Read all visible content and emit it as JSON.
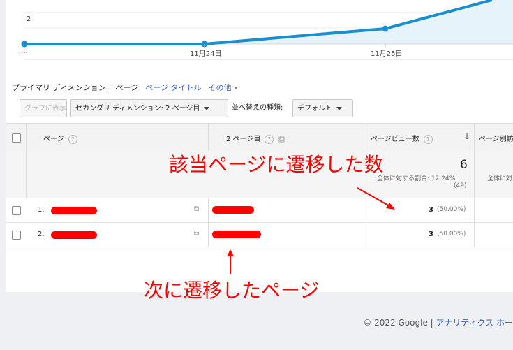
{
  "chart": {
    "y_tick": "2",
    "x_ticks": [
      "…",
      "11月24日",
      "11月25日"
    ],
    "line_color": "#1a8fd0",
    "fill_color": "#e6f3fb"
  },
  "dimension_bar": {
    "primary_label": "プライマリ ディメンション:",
    "current": "ページ",
    "page_title_link": "ページ タイトル",
    "other_link": "その他"
  },
  "toolbar": {
    "graph_button": "グラフに表示",
    "secondary_dimension": "セカンダリ ディメンション: 2 ページ目",
    "sort_label": "並べ替えの種類:",
    "sort_value": "デフォルト"
  },
  "table": {
    "headers": {
      "page": "ページ",
      "second_page": "2 ページ目",
      "pageviews": "ページビュー数",
      "page_other": "ページ別訪"
    },
    "totals": {
      "pageviews": "6",
      "share_line1": "全体に対する割合: 12.24%",
      "share_line2": "(49)",
      "other_cut": "全体に対"
    },
    "rows": [
      {
        "index": "1.",
        "pageviews": "3",
        "pct": "(50.00%)"
      },
      {
        "index": "2.",
        "pageviews": "3",
        "pct": "(50.00%)"
      }
    ]
  },
  "annotations": {
    "top": "該当ページに遷移した数",
    "bottom": "次に遷移したページ",
    "color": "#ff0000"
  },
  "footer": {
    "copyright": "© 2022 Google | ",
    "link": "アナリティクス ホー"
  }
}
